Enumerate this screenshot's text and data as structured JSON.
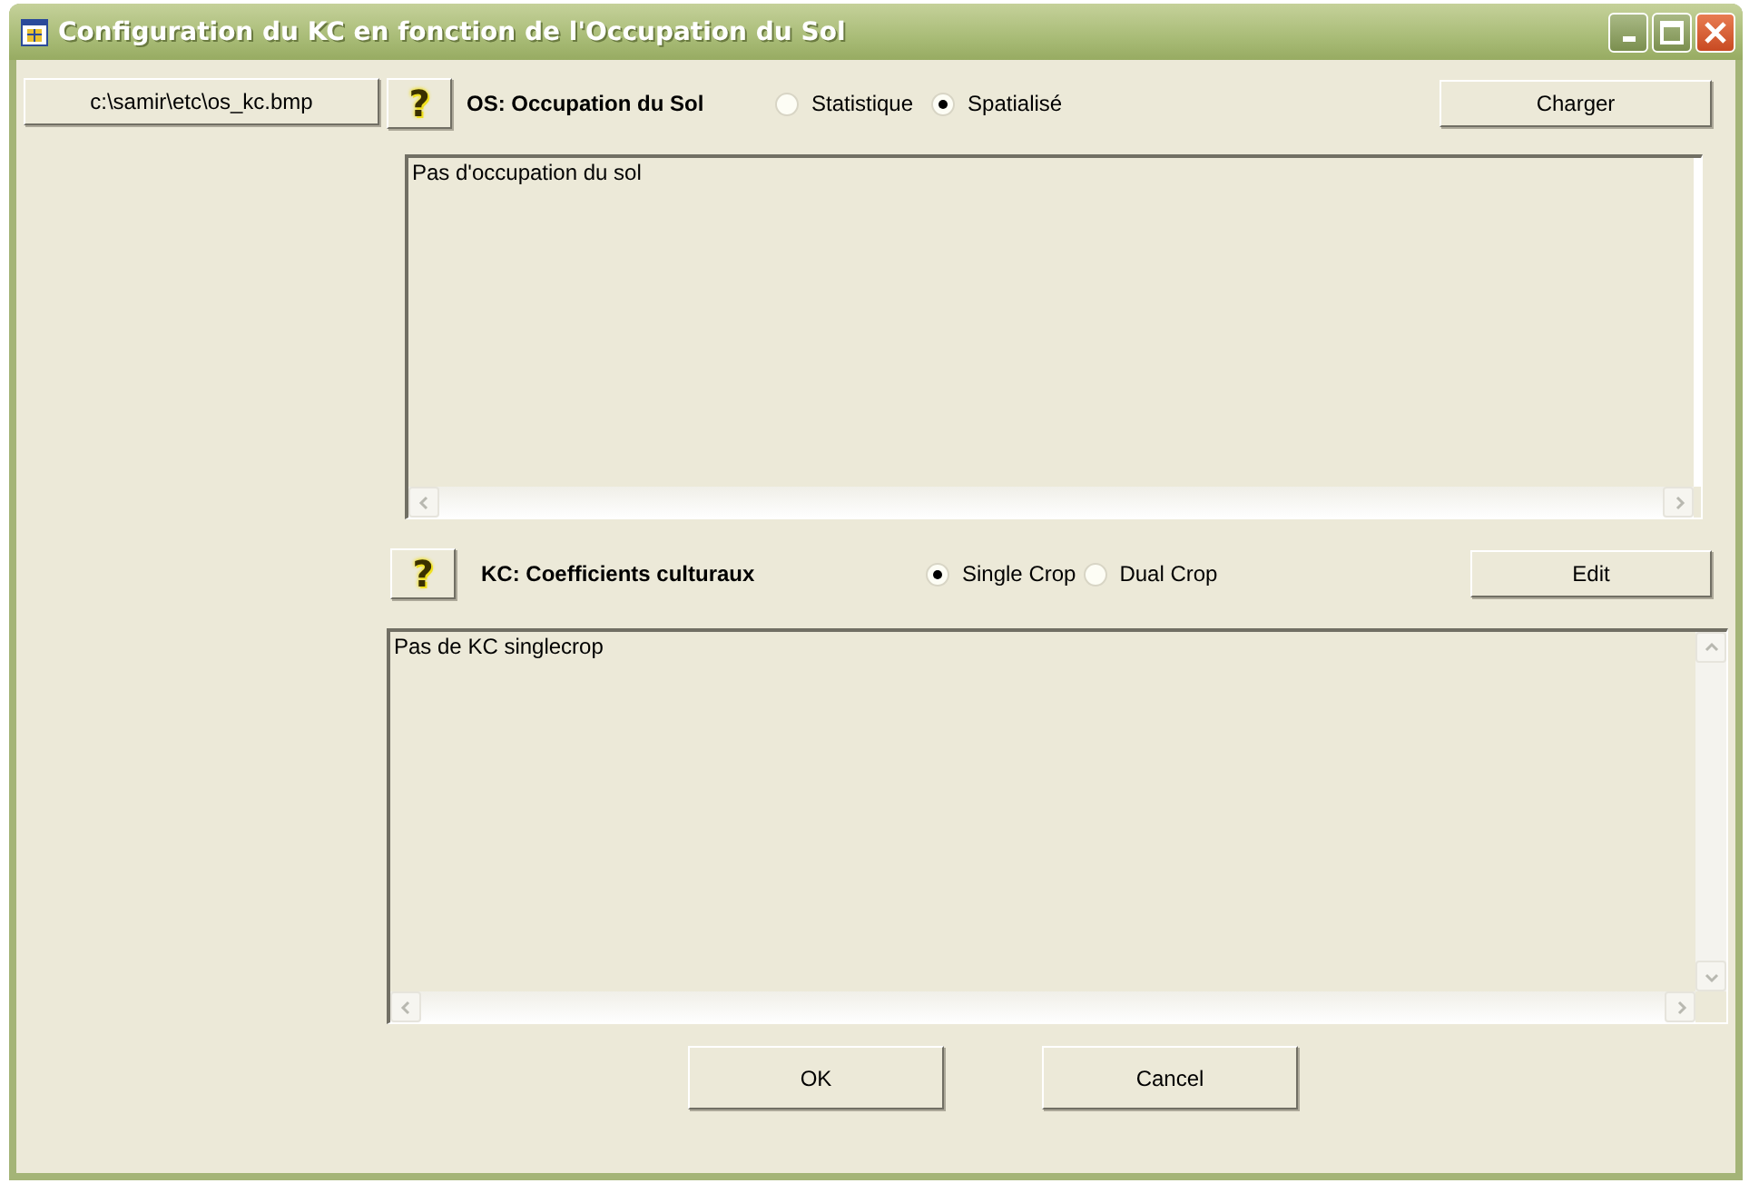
{
  "window": {
    "title": "Configuration du KC en fonction de l'Occupation du Sol"
  },
  "path_button": "c:\\samir\\etc\\os_kc.bmp",
  "sections": [
    {
      "help_button": "?",
      "label": "OS: Occupation du Sol",
      "radios": [
        {
          "label": "Statistique",
          "selected": false
        },
        {
          "label": "Spatialisé",
          "selected": true
        }
      ],
      "action_button": "Charger",
      "text": "Pas d'occupation du sol"
    },
    {
      "help_button": "?",
      "label": "KC: Coefficients culturaux",
      "radios": [
        {
          "label": "Single Crop",
          "selected": true
        },
        {
          "label": "Dual Crop",
          "selected": false
        }
      ],
      "action_button": "Edit",
      "text": "Pas de KC singlecrop"
    }
  ],
  "buttons": [
    "OK",
    "Cancel"
  ]
}
